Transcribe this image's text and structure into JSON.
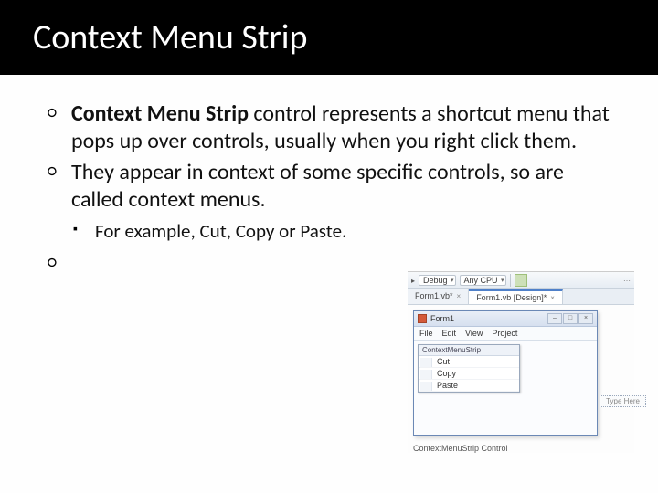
{
  "title": "Context Menu Strip",
  "content": {
    "item1_bold": "Context Menu Strip",
    "item1_rest": " control represents a shortcut menu that pops up over controls, usually when you right click them.",
    "item2": "They appear in context of some specific controls, so are called context menus.",
    "sub1": "For example, Cut, Copy or Paste."
  },
  "vs": {
    "toolbar_debug": "Debug",
    "toolbar_anycpu": "Any CPU",
    "tab1": "Form1.vb*",
    "tab2": "Form1.vb [Design]*",
    "form_title": "Form1",
    "menu_file": "File",
    "menu_edit": "Edit",
    "menu_view": "View",
    "menu_project": "Project",
    "ctx_header": "ContextMenuStrip",
    "ctx_cut": "Cut",
    "ctx_copy": "Copy",
    "ctx_paste": "Paste",
    "type_here": "Type Here",
    "caption": "ContextMenuStrip Control"
  }
}
